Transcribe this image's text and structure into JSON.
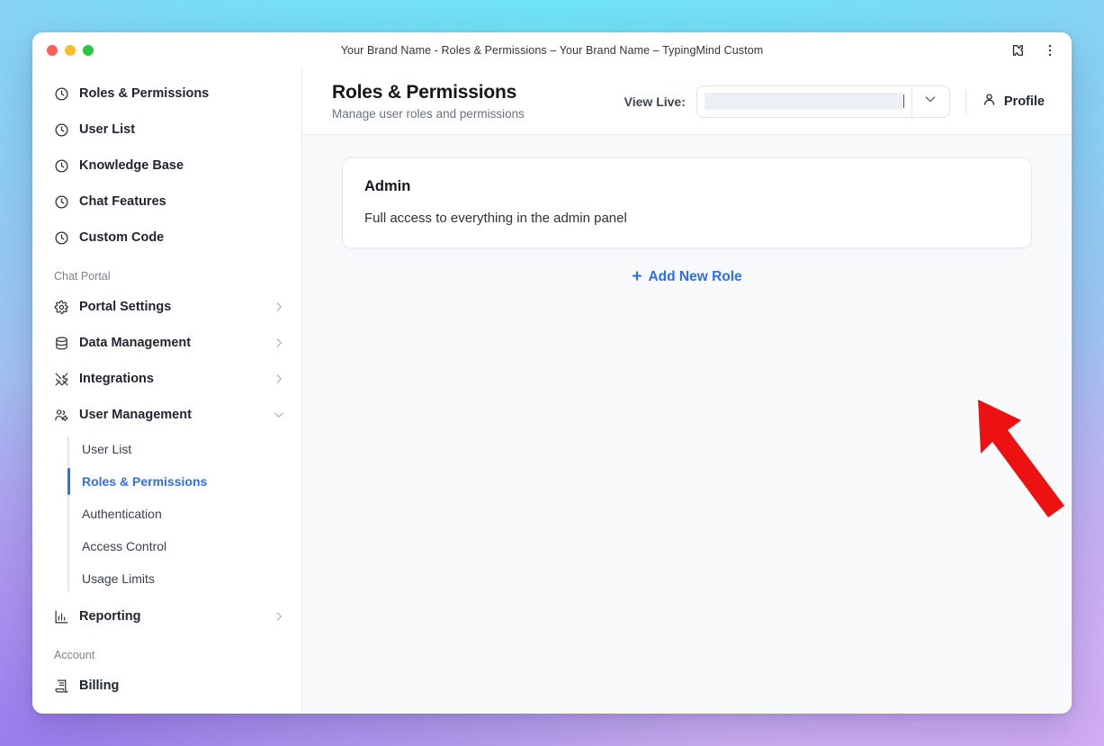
{
  "window": {
    "title": "Your Brand Name - Roles & Permissions – Your Brand Name – TypingMind Custom",
    "traffic_lights": [
      "close",
      "minimize",
      "maximize"
    ],
    "extensions_icon": "puzzle-piece-icon",
    "menu_icon": "kebab-menu-icon"
  },
  "sidebar": {
    "recent_items": [
      {
        "label": "Roles & Permissions",
        "icon": "clock-icon"
      },
      {
        "label": "User List",
        "icon": "clock-icon"
      },
      {
        "label": "Knowledge Base",
        "icon": "clock-icon"
      },
      {
        "label": "Chat Features",
        "icon": "clock-icon"
      },
      {
        "label": "Custom Code",
        "icon": "clock-icon"
      }
    ],
    "sections": [
      {
        "label": "Chat Portal",
        "items": [
          {
            "label": "Portal Settings",
            "icon": "gear-icon",
            "chevron": "right",
            "expanded": false
          },
          {
            "label": "Data Management",
            "icon": "database-icon",
            "chevron": "right",
            "expanded": false
          },
          {
            "label": "Integrations",
            "icon": "tools-icon",
            "chevron": "right",
            "expanded": false
          },
          {
            "label": "User Management",
            "icon": "users-gear-icon",
            "chevron": "down",
            "expanded": true
          }
        ],
        "submenu": [
          {
            "label": "User List",
            "active": false
          },
          {
            "label": "Roles & Permissions",
            "active": true
          },
          {
            "label": "Authentication",
            "active": false
          },
          {
            "label": "Access Control",
            "active": false
          },
          {
            "label": "Usage Limits",
            "active": false
          }
        ],
        "trailing_items": [
          {
            "label": "Reporting",
            "icon": "bar-chart-icon",
            "chevron": "right",
            "expanded": false
          }
        ]
      },
      {
        "label": "Account",
        "items": [
          {
            "label": "Billing",
            "icon": "receipt-icon",
            "chevron": "none",
            "expanded": false
          }
        ],
        "submenu": [],
        "trailing_items": []
      }
    ]
  },
  "header": {
    "title": "Roles & Permissions",
    "subtitle": "Manage user roles and permissions",
    "view_live_label": "View Live:",
    "url_value": "",
    "url_placeholder": "",
    "dropdown_icon": "chevron-down-icon",
    "profile_label": "Profile",
    "profile_icon": "user-icon"
  },
  "main": {
    "roles": [
      {
        "name": "Admin",
        "description": "Full access to everything in the admin panel"
      }
    ],
    "add_role_label": "Add New Role",
    "add_role_icon": "plus-icon"
  },
  "annotation": {
    "type": "arrow",
    "color": "#ee1111",
    "outline": "#ffffff",
    "points_to": "Add New Role"
  },
  "colors": {
    "accent": "#2f6ef5",
    "annotation_red": "#ee1111",
    "page_background": "#f8f9fb",
    "card_background": "#ffffff",
    "sidebar_background": "#ffffff"
  }
}
